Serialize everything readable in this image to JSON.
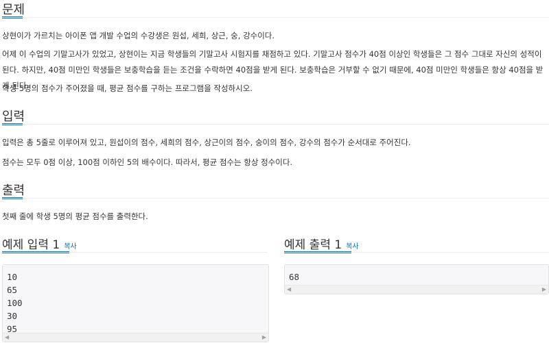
{
  "sections": {
    "problem": {
      "title": "문제",
      "paragraphs": [
        "상현이가 가르치는 아이폰 앱 개발 수업의 수강생은 원섭, 세희, 상근, 숭, 강수이다.",
        "어제 이 수업의 기말고사가 있었고, 상현이는 지금 학생들의 기말고사 시험지를 채점하고 있다. 기말고사 점수가 40점 이상인 학생들은 그 점수 그대로 자신의 성적이 된다. 하지만, 40점 미만인 학생들은 보충학습을 듣는 조건을 수락하면 40점을 받게 된다. 보충학습은 거부할 수 없기 때문에, 40점 미만인 학생들은 항상 40점을 받게 된다.",
        "학생 5명의 점수가 주어졌을 때, 평균 점수를 구하는 프로그램을 작성하시오."
      ]
    },
    "input": {
      "title": "입력",
      "paragraphs": [
        "입력은 총 5줄로 이루어져 있고, 원섭이의 점수, 세희의 점수, 상근이의 점수, 숭이의 점수, 강수의 점수가 순서대로 주어진다.",
        "점수는 모두 0점 이상, 100점 이하인 5의 배수이다. 따라서, 평균 점수는 항상 정수이다."
      ]
    },
    "output": {
      "title": "출력",
      "paragraphs": [
        "첫째 줄에 학생 5명의 평균 점수를 출력한다."
      ]
    }
  },
  "samples": {
    "input": {
      "title": "예제 입력 1",
      "copy_label": "복사",
      "content": "10\n65\n100\n30\n95"
    },
    "output": {
      "title": "예제 출력 1",
      "copy_label": "복사",
      "content": "68"
    }
  },
  "scrollbar": {
    "left_arrow": "◀",
    "right_arrow": "▶"
  },
  "colors": {
    "accent": "#0076c0",
    "sample_bg": "#f7f7f9",
    "sample_border": "#e1e1e8"
  }
}
